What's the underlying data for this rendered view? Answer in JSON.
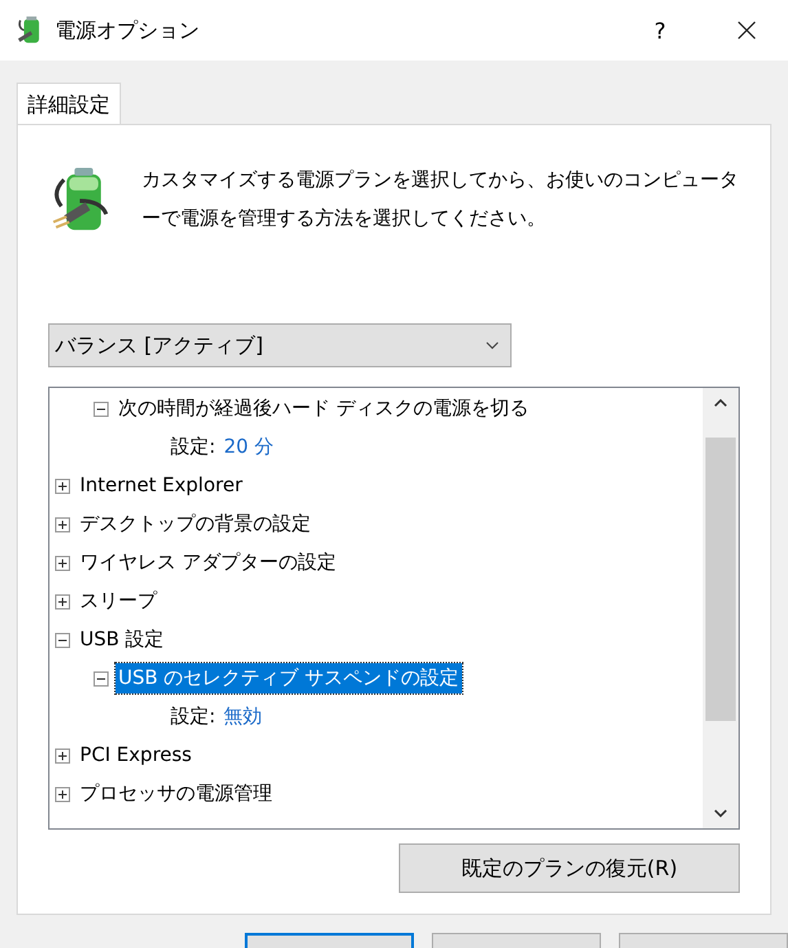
{
  "window": {
    "title": "電源オプション",
    "help": "?"
  },
  "tabs": [
    {
      "label": "詳細設定",
      "selected": true
    }
  ],
  "description": "カスタマイズする電源プランを選択してから、お使いのコンピューターで電源を管理する方法を選択してください。",
  "plan_dropdown": {
    "value": "バランス [アクティブ]"
  },
  "tree": [
    {
      "children": [
        {
          "kind": "group",
          "label": "次の時間が経過後ハード ディスクの電源を切る",
          "expanded": true,
          "selected": false,
          "children": [
            {
              "kind": "setting",
              "label": "設定:",
              "value": "20 分"
            }
          ]
        }
      ]
    },
    {
      "kind": "group",
      "label": "Internet Explorer",
      "expanded": false,
      "selected": false
    },
    {
      "kind": "group",
      "label": "デスクトップの背景の設定",
      "expanded": false,
      "selected": false
    },
    {
      "kind": "group",
      "label": "ワイヤレス アダプターの設定",
      "expanded": false,
      "selected": false
    },
    {
      "kind": "group",
      "label": "スリープ",
      "expanded": false,
      "selected": false
    },
    {
      "kind": "group",
      "label": "USB 設定",
      "expanded": true,
      "selected": false,
      "children": [
        {
          "kind": "group",
          "label": "USB のセレクティブ サスペンドの設定",
          "expanded": true,
          "selected": true,
          "children": [
            {
              "kind": "setting",
              "label": "設定:",
              "value": "無効"
            }
          ]
        }
      ]
    },
    {
      "kind": "group",
      "label": "PCI Express",
      "expanded": false,
      "selected": false
    },
    {
      "kind": "group",
      "label": "プロセッサの電源管理",
      "expanded": false,
      "selected": false
    }
  ],
  "restore_button": "既定のプランの復元(R)",
  "dialog_buttons": [
    {
      "default": true
    },
    {
      "default": false
    },
    {
      "default": false
    }
  ]
}
